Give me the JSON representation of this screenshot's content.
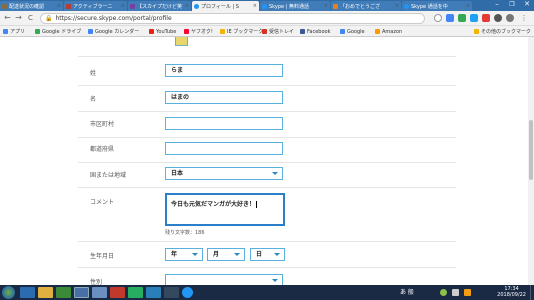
{
  "browser": {
    "tabs": [
      {
        "title": "配送状況の確認",
        "color": "#8a6d3b"
      },
      {
        "title": "アクティブラーニ",
        "color": "#c0392b"
      },
      {
        "title": "【スカイプだけど英",
        "color": "#7b3fa0"
      },
      {
        "title": "プロフィール | S",
        "color": "#2196f3"
      },
      {
        "title": "Skype | 無料通話",
        "color": "#2196f3"
      },
      {
        "title": "「おめでとうござ",
        "color": "#e67e22"
      },
      {
        "title": "Skype 通話を中",
        "color": "#2196f3"
      }
    ],
    "tab_close": "×",
    "window_controls": {
      "minimize": "–",
      "restore": "❐",
      "close": "✕"
    },
    "back": "←",
    "forward": "→",
    "reload": "C",
    "lock": "🔒",
    "url": "https://secure.skype.com/portal/profile",
    "bookmarks": [
      {
        "label": "アプリ",
        "color": "#4285f4"
      },
      {
        "label": "Google ドライブ",
        "color": "#34a853"
      },
      {
        "label": "Google カレンダー",
        "color": "#4285f4"
      },
      {
        "label": "YouTube",
        "color": "#e62117"
      },
      {
        "label": "ヤフオク!",
        "color": "#ff0033"
      },
      {
        "label": "IE ブックマーク",
        "color": "#f4b400"
      },
      {
        "label": "受信トレイ",
        "color": "#d93025"
      },
      {
        "label": "Facebook",
        "color": "#3b5998"
      },
      {
        "label": "Google",
        "color": "#4285f4"
      },
      {
        "label": "Amazon",
        "color": "#ff9900"
      }
    ],
    "other_bookmarks": "その他のブックマーク"
  },
  "form": {
    "surname": {
      "label": "姓",
      "value": "らま"
    },
    "given_name": {
      "label": "名",
      "value": "はまの"
    },
    "city": {
      "label": "市区町村",
      "value": ""
    },
    "prefecture": {
      "label": "都道府県",
      "value": ""
    },
    "country": {
      "label": "国または地域",
      "value": "日本"
    },
    "comment": {
      "label": "コメント",
      "value": "今日も元気だマンガが大好き！"
    },
    "remaining": "残り文字数：186",
    "birthdate": {
      "label": "生年月日",
      "year": "年",
      "month": "月",
      "day": "日"
    },
    "gender": {
      "label": "性別",
      "value": ""
    }
  },
  "taskbar": {
    "tray_text": "あ 般",
    "time": "17:34",
    "date": "2018/09/22"
  },
  "colors": {
    "input_border": "#5ab0dc",
    "textarea_focus": "#2a7fc8",
    "taskbar": "#1a2a44"
  }
}
